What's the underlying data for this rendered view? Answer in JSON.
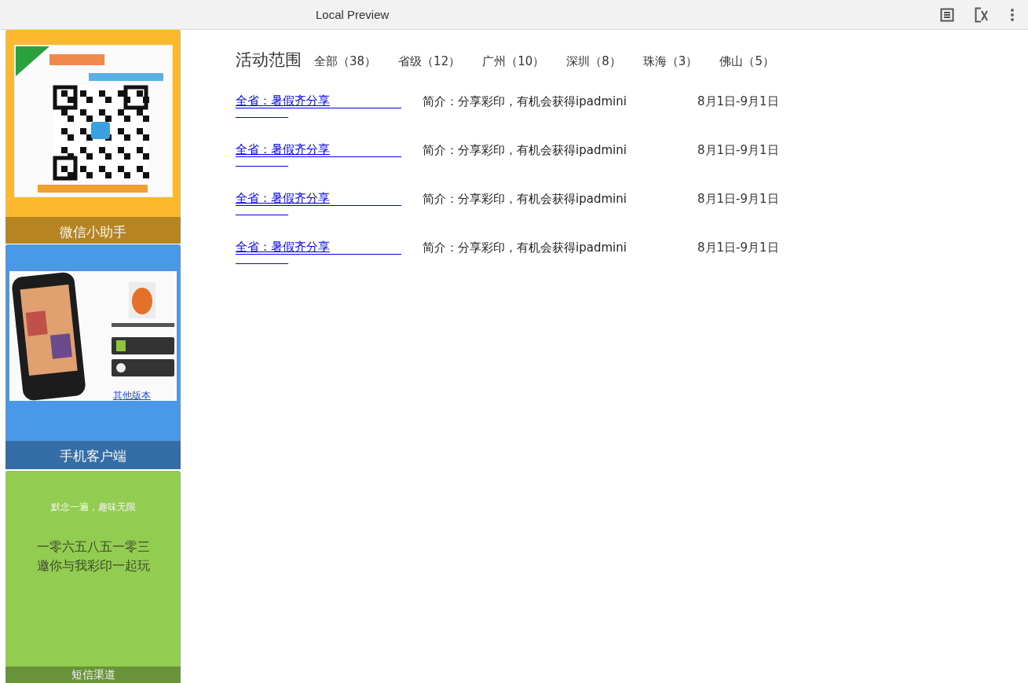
{
  "window": {
    "title": "Local Preview"
  },
  "sidebar": {
    "panels": [
      {
        "kind": "qr",
        "color": "#fdb92e",
        "label": "微信小助手"
      },
      {
        "kind": "app",
        "color": "#4a99e8",
        "label": "手机客户端",
        "link": "其他版本"
      },
      {
        "kind": "sms",
        "color": "#92cc50",
        "label": "短信渠道",
        "tagline": "默念一遍，趣味无限",
        "lines": [
          "一零六五八五一零三",
          "邀你与我彩印一起玩"
        ]
      }
    ]
  },
  "filter": {
    "title": "活动范围",
    "tabs": [
      "全部（38）",
      "省级（12）",
      "广州（10）",
      "深圳（8）",
      "珠海（3）",
      "佛山（5）"
    ]
  },
  "activities": [
    {
      "name": "全省：暑假齐分享",
      "intro": "简介：分享彩印，有机会获得ipadmini",
      "dates": "8月1日-9月1日"
    },
    {
      "name": "全省：暑假齐分享",
      "intro": "简介：分享彩印，有机会获得ipadmini",
      "dates": "8月1日-9月1日"
    },
    {
      "name": "全省：暑假齐分享",
      "intro": "简介：分享彩印，有机会获得ipadmini",
      "dates": "8月1日-9月1日"
    },
    {
      "name": "全省：暑假齐分享",
      "intro": "简介：分享彩印，有机会获得ipadmini",
      "dates": "8月1日-9月1日"
    }
  ]
}
